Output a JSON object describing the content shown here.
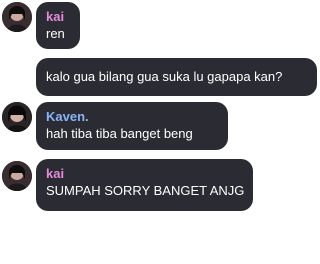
{
  "colors": {
    "bubble_bg": "#2b2b33",
    "text": "#ffffff",
    "name_kai": "#e58ad8",
    "name_kaven": "#8ab4f8",
    "page_bg": "#ffffff"
  },
  "messages": [
    {
      "sender": "kai",
      "sender_color": "#e58ad8",
      "lines": [
        "ren"
      ]
    },
    {
      "sender": "",
      "lines": [
        "kalo gua bilang gua suka lu gapapa kan?"
      ]
    },
    {
      "sender": "Kaven.",
      "sender_color": "#8ab4f8",
      "lines": [
        "hah tiba tiba banget beng"
      ]
    },
    {
      "sender": "kai",
      "sender_color": "#e58ad8",
      "lines": [
        "SUMPAH SORRY BANGET ANJG"
      ]
    }
  ]
}
